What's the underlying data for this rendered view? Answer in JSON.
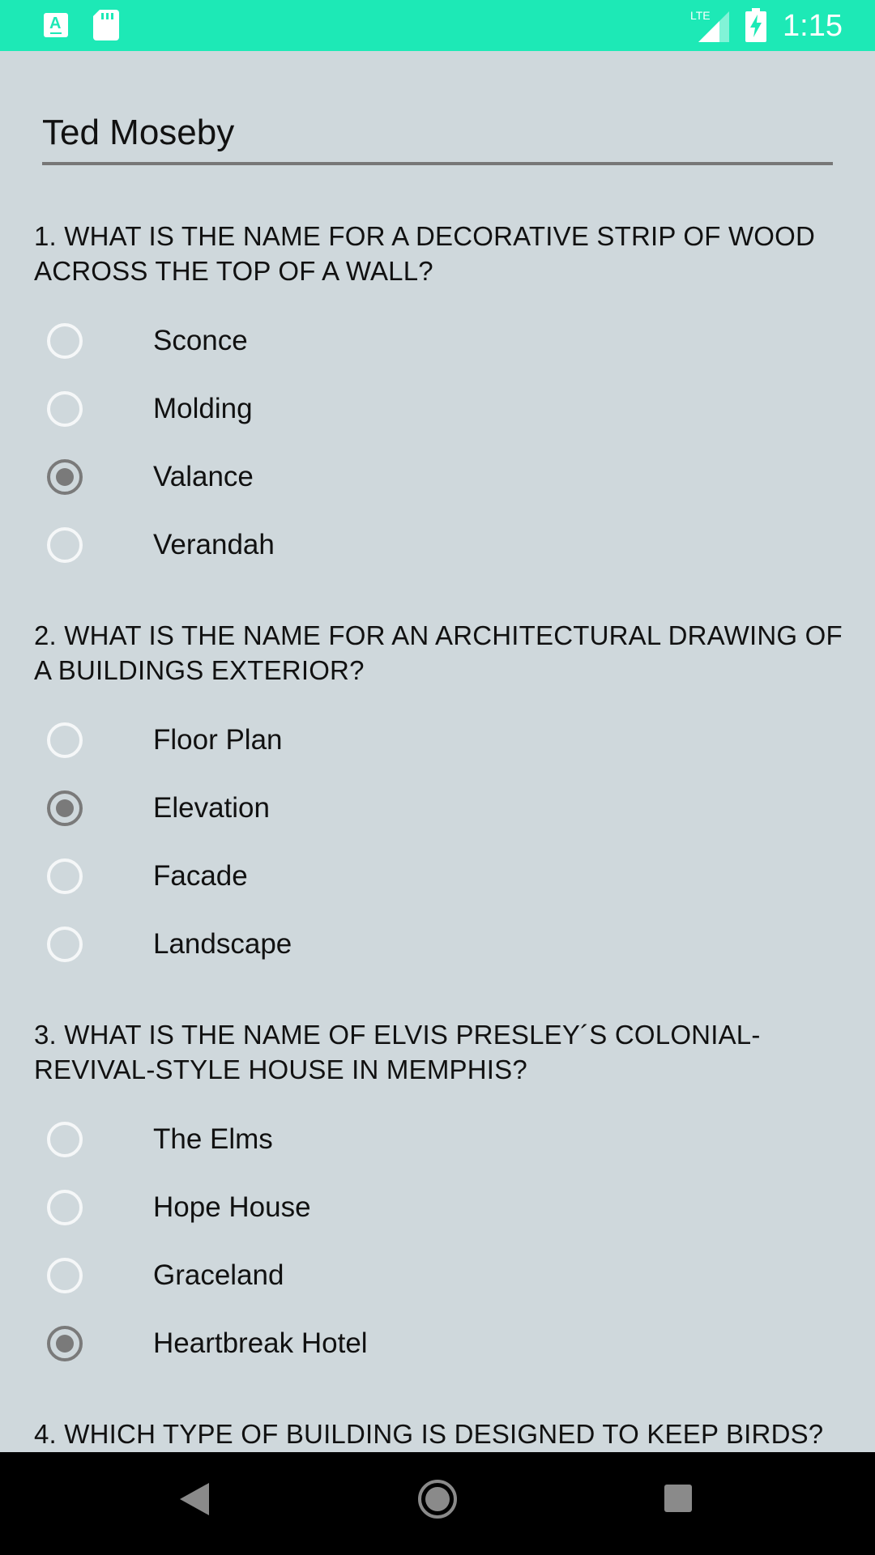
{
  "status_bar": {
    "time": "1:15",
    "icons": [
      "app-a-icon",
      "sd-card-icon",
      "lte-signal-icon",
      "battery-charging-icon"
    ],
    "background": "#1de9b6",
    "lte_label": "LTE"
  },
  "form": {
    "name_value": "Ted Moseby",
    "background": "#cfd8dc",
    "questions": [
      {
        "text": "1. WHAT IS THE NAME FOR A DECORATIVE STRIP OF WOOD ACROSS THE TOP OF A WALL?",
        "options": [
          {
            "label": "Sconce",
            "checked": false
          },
          {
            "label": "Molding",
            "checked": false
          },
          {
            "label": "Valance",
            "checked": true
          },
          {
            "label": "Verandah",
            "checked": false
          }
        ]
      },
      {
        "text": "2. WHAT IS THE NAME FOR AN ARCHITECTURAL DRAWING OF A BUILDINGS EXTERIOR?",
        "options": [
          {
            "label": "Floor Plan",
            "checked": false
          },
          {
            "label": "Elevation",
            "checked": true
          },
          {
            "label": "Facade",
            "checked": false
          },
          {
            "label": "Landscape",
            "checked": false
          }
        ]
      },
      {
        "text": "3. WHAT IS THE NAME OF ELVIS PRESLEY´S COLONIAL-REVIVAL-STYLE HOUSE IN MEMPHIS?",
        "options": [
          {
            "label": "The Elms",
            "checked": false
          },
          {
            "label": "Hope House",
            "checked": false
          },
          {
            "label": "Graceland",
            "checked": false
          },
          {
            "label": "Heartbreak Hotel",
            "checked": true
          }
        ]
      },
      {
        "text": "4. WHICH TYPE OF BUILDING IS DESIGNED TO KEEP BIRDS?",
        "options": []
      }
    ]
  },
  "nav_bar": {
    "icons": [
      "back-icon",
      "home-icon",
      "recents-icon"
    ]
  }
}
